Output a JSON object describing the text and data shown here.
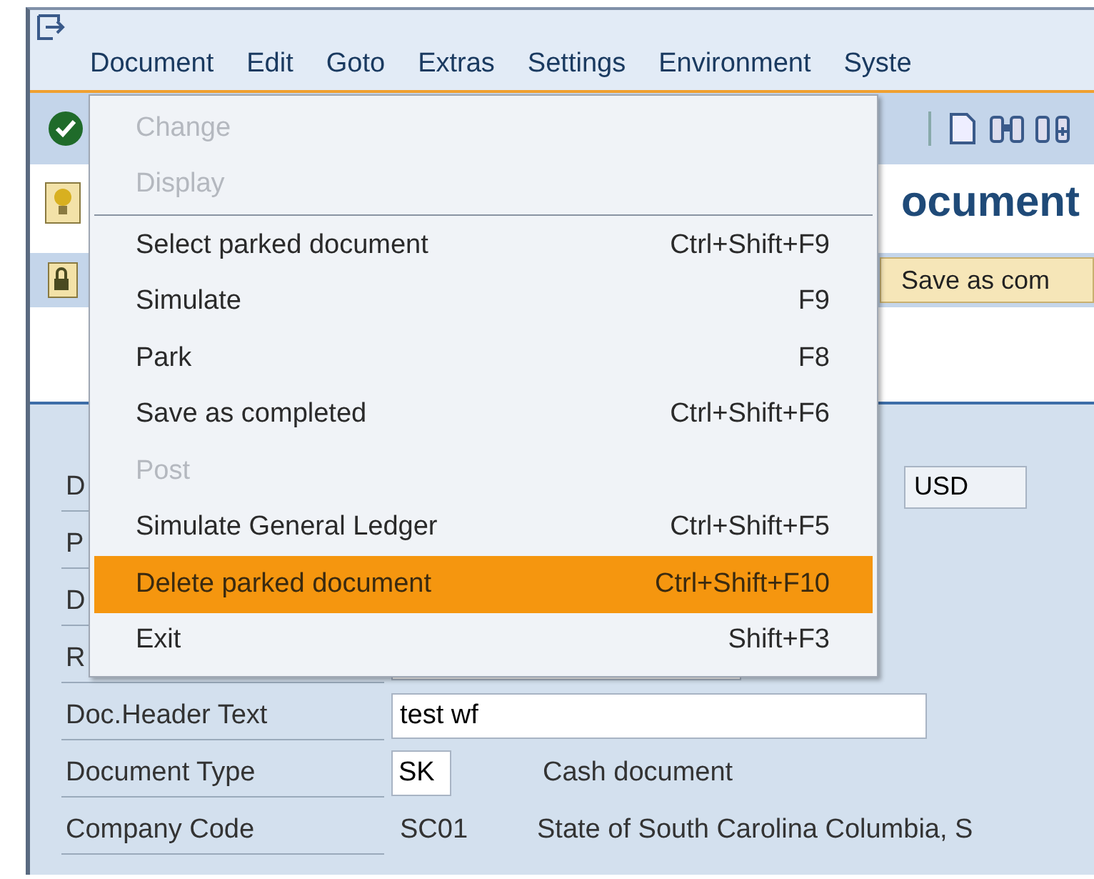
{
  "menu_bar": {
    "items": [
      {
        "label": "Document"
      },
      {
        "label": "Edit"
      },
      {
        "label": "Goto"
      },
      {
        "label": "Extras"
      },
      {
        "label": "Settings"
      },
      {
        "label": "Environment"
      },
      {
        "label": "Syste"
      }
    ]
  },
  "title": "ocument",
  "app_toolbar": {
    "button": "Save as com"
  },
  "form": {
    "rows": [
      {
        "kind": "currency",
        "label": "D",
        "value": "USD"
      },
      {
        "kind": "empty",
        "label": "P"
      },
      {
        "kind": "empty",
        "label": "D"
      },
      {
        "kind": "field",
        "label": "R"
      },
      {
        "kind": "wide_field",
        "label": "Doc.Header Text",
        "value": "test wf"
      },
      {
        "kind": "code_field",
        "label": "Document Type",
        "value": "SK",
        "description": "Cash document"
      },
      {
        "kind": "text",
        "label": "Company Code",
        "value": "SC01",
        "description": "State of South Carolina Columbia, S"
      }
    ]
  },
  "dropdown": {
    "items": [
      {
        "kind": "item",
        "label": "Change",
        "disabled": true,
        "selected": false
      },
      {
        "kind": "item",
        "label": "Display",
        "disabled": true,
        "selected": false
      },
      {
        "kind": "separator"
      },
      {
        "kind": "item",
        "label": "Select parked document",
        "shortcut": "Ctrl+Shift+F9",
        "disabled": false,
        "selected": false
      },
      {
        "kind": "item",
        "label": "Simulate",
        "shortcut": "F9",
        "disabled": false,
        "selected": false
      },
      {
        "kind": "item",
        "label": "Park",
        "shortcut": "F8",
        "disabled": false,
        "selected": false
      },
      {
        "kind": "item",
        "label": "Save as completed",
        "shortcut": "Ctrl+Shift+F6",
        "disabled": false,
        "selected": false
      },
      {
        "kind": "item",
        "label": "Post",
        "disabled": true,
        "selected": false
      },
      {
        "kind": "item",
        "label": "Simulate General Ledger",
        "shortcut": "Ctrl+Shift+F5",
        "disabled": false,
        "selected": false
      },
      {
        "kind": "item",
        "label": "Delete parked document",
        "shortcut": "Ctrl+Shift+F10",
        "disabled": false,
        "selected": true
      },
      {
        "kind": "item",
        "label": "Exit",
        "shortcut": "Shift+F3",
        "disabled": false,
        "selected": false
      }
    ]
  }
}
